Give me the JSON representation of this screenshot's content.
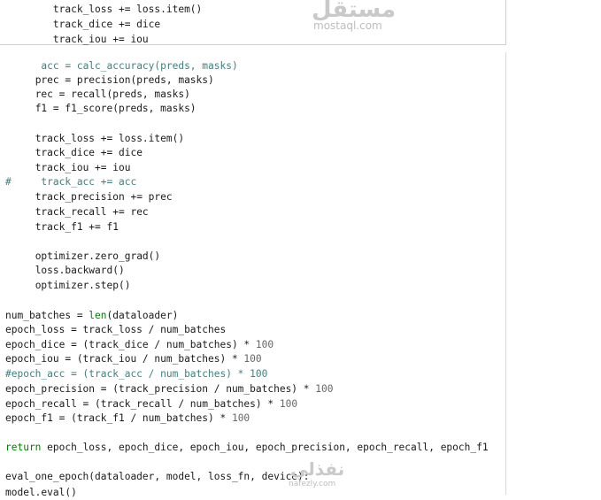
{
  "watermark": {
    "top_arabic": "مستقل",
    "top_latin": "mostaql.com",
    "bottom_arabic": "نفذلي",
    "bottom_latin": "nafezly.com"
  },
  "colors": {
    "text": "#1a1a1a",
    "keyword": "#008000",
    "builtin": "#008000",
    "comment": "#408080",
    "number": "#666666",
    "background": "#ffffff"
  },
  "code_lines": [
    {
      "indent": "        ",
      "tokens": [
        {
          "t": "track_loss += loss.item()"
        }
      ]
    },
    {
      "indent": "        ",
      "tokens": [
        {
          "t": "track_dice += dice"
        }
      ]
    },
    {
      "indent": "        ",
      "tokens": [
        {
          "t": "track_iou += iou"
        }
      ]
    },
    {
      "indent": "",
      "tokens": []
    },
    {
      "indent": "      ",
      "tokens": [
        {
          "t": "acc = calc_accuracy(preds, masks)",
          "c": "c"
        }
      ]
    },
    {
      "indent": "     ",
      "tokens": [
        {
          "t": "prec = precision(preds, masks)"
        }
      ]
    },
    {
      "indent": "     ",
      "tokens": [
        {
          "t": "rec = recall(preds, masks)"
        }
      ]
    },
    {
      "indent": "     ",
      "tokens": [
        {
          "t": "f1 = f1_score(preds, masks)"
        }
      ]
    },
    {
      "indent": "",
      "tokens": []
    },
    {
      "indent": "     ",
      "tokens": [
        {
          "t": "track_loss += loss.item()"
        }
      ]
    },
    {
      "indent": "     ",
      "tokens": [
        {
          "t": "track_dice += dice"
        }
      ]
    },
    {
      "indent": "     ",
      "tokens": [
        {
          "t": "track_iou += iou"
        }
      ]
    },
    {
      "indent": "",
      "tokens": [
        {
          "t": "#     track_acc += acc",
          "c": "c"
        }
      ]
    },
    {
      "indent": "     ",
      "tokens": [
        {
          "t": "track_precision += prec"
        }
      ]
    },
    {
      "indent": "     ",
      "tokens": [
        {
          "t": "track_recall += rec"
        }
      ]
    },
    {
      "indent": "     ",
      "tokens": [
        {
          "t": "track_f1 += f1"
        }
      ]
    },
    {
      "indent": "",
      "tokens": []
    },
    {
      "indent": "     ",
      "tokens": [
        {
          "t": "optimizer.zero_grad()"
        }
      ]
    },
    {
      "indent": "     ",
      "tokens": [
        {
          "t": "loss.backward()"
        }
      ]
    },
    {
      "indent": "     ",
      "tokens": [
        {
          "t": "optimizer.step()"
        }
      ]
    },
    {
      "indent": "",
      "tokens": []
    },
    {
      "indent": "",
      "tokens": [
        {
          "t": "num_batches = "
        },
        {
          "t": "len",
          "c": "b"
        },
        {
          "t": "(dataloader)"
        }
      ]
    },
    {
      "indent": "",
      "tokens": [
        {
          "t": "epoch_loss = track_loss / num_batches"
        }
      ]
    },
    {
      "indent": "",
      "tokens": [
        {
          "t": "epoch_dice = (track_dice / num_batches) * "
        },
        {
          "t": "100",
          "c": "n"
        }
      ]
    },
    {
      "indent": "",
      "tokens": [
        {
          "t": "epoch_iou = (track_iou / num_batches) * "
        },
        {
          "t": "100",
          "c": "n"
        }
      ]
    },
    {
      "indent": "",
      "tokens": [
        {
          "t": "#epoch_acc = (track_acc / num_batches) * 100",
          "c": "c"
        }
      ]
    },
    {
      "indent": "",
      "tokens": [
        {
          "t": "epoch_precision = (track_precision / num_batches) * "
        },
        {
          "t": "100",
          "c": "n"
        }
      ]
    },
    {
      "indent": "",
      "tokens": [
        {
          "t": "epoch_recall = (track_recall / num_batches) * "
        },
        {
          "t": "100",
          "c": "n"
        }
      ]
    },
    {
      "indent": "",
      "tokens": [
        {
          "t": "epoch_f1 = (track_f1 / num_batches) * "
        },
        {
          "t": "100",
          "c": "n"
        }
      ]
    },
    {
      "indent": "",
      "tokens": []
    },
    {
      "indent": "",
      "tokens": [
        {
          "t": "return",
          "c": "k"
        },
        {
          "t": " epoch_loss, epoch_dice, epoch_iou, epoch_precision, epoch_recall, epoch_f1"
        }
      ]
    },
    {
      "indent": "",
      "tokens": []
    },
    {
      "indent": "",
      "tokens": [
        {
          "t": "eval_one_epoch(dataloader, model, loss_fn, device):"
        }
      ]
    },
    {
      "indent": "",
      "tokens": [
        {
          "t": "model.eval()"
        }
      ]
    }
  ]
}
